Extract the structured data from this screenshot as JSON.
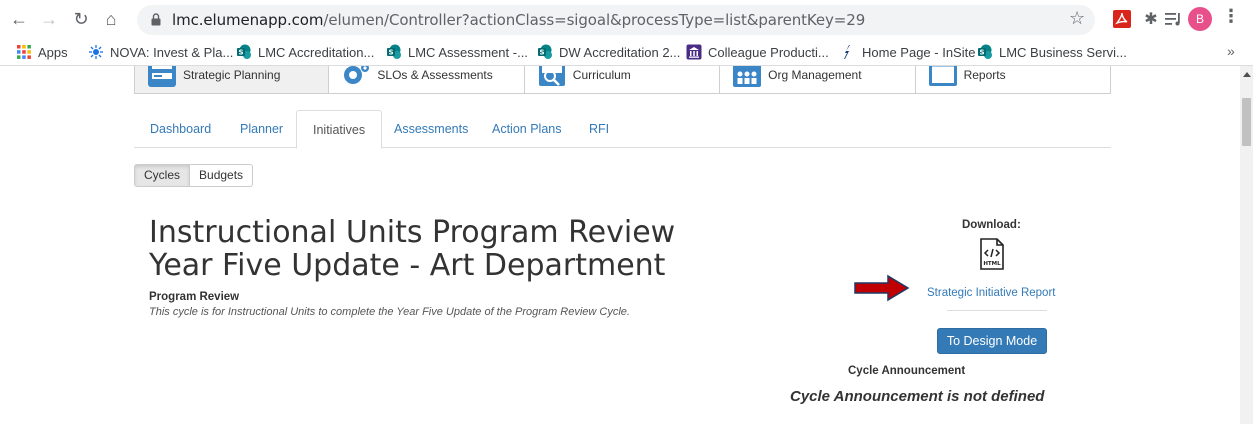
{
  "browser": {
    "url_host": "lmc.elumenapp.com",
    "url_path": "/elumen/Controller?actionClass=sigoal&processType=list&parentKey=29",
    "profile_initial": "B",
    "bookmarks": [
      {
        "label": "Apps",
        "icon": "apps-grid-icon"
      },
      {
        "label": "NOVA: Invest & Pla...",
        "icon": "nova-icon"
      },
      {
        "label": "LMC Accreditation...",
        "icon": "sharepoint-icon"
      },
      {
        "label": "LMC Assessment -...",
        "icon": "sharepoint-icon"
      },
      {
        "label": "DW Accreditation 2...",
        "icon": "sharepoint-icon"
      },
      {
        "label": "Colleague Producti...",
        "icon": "colleague-icon"
      },
      {
        "label": "Home Page - InSite",
        "icon": "insite-icon"
      },
      {
        "label": "LMC Business Servi...",
        "icon": "sharepoint-icon"
      }
    ],
    "bookmarks_more": "»"
  },
  "modules": [
    {
      "label": "Strategic Planning",
      "icon": "strategic-planning-icon",
      "active": true
    },
    {
      "label": "SLOs & Assessments",
      "icon": "slos-icon",
      "active": false
    },
    {
      "label": "Curriculum",
      "icon": "curriculum-icon",
      "active": false
    },
    {
      "label": "Org Management",
      "icon": "org-management-icon",
      "active": false
    },
    {
      "label": "Reports",
      "icon": "reports-icon",
      "active": false
    }
  ],
  "tabs": [
    {
      "label": "Dashboard",
      "active": false
    },
    {
      "label": "Planner",
      "active": false
    },
    {
      "label": "Initiatives",
      "active": true
    },
    {
      "label": "Assessments",
      "active": false
    },
    {
      "label": "Action Plans",
      "active": false
    },
    {
      "label": "RFI",
      "active": false
    }
  ],
  "subtabs": [
    {
      "label": "Cycles",
      "active": true
    },
    {
      "label": "Budgets",
      "active": false
    }
  ],
  "page": {
    "title_line1": "Instructional Units Program Review",
    "title_line2": "Year Five Update - Art Department",
    "subtitle_label": "Program Review",
    "subtitle_desc": "This cycle is for Instructional Units to complete the Year Five Update of the Program Review Cycle."
  },
  "sidebar": {
    "download_label": "Download:",
    "html_icon_text": "HTML",
    "report_link": "Strategic Initiative Report",
    "design_button": "To Design Mode",
    "announcement_label": "Cycle Announcement",
    "announcement_text": "Cycle Announcement is not defined"
  },
  "colors": {
    "link": "#337ab7",
    "primary_button": "#337ab7",
    "arrow": "#c00000"
  }
}
